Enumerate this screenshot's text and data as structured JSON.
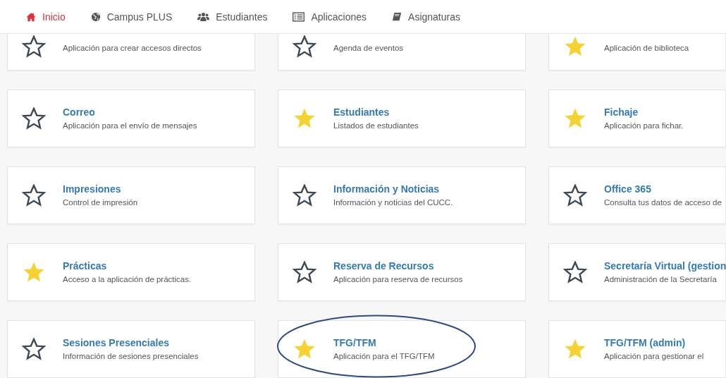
{
  "nav": [
    {
      "label": "Inicio",
      "selected": true
    },
    {
      "label": "Campus PLUS",
      "selected": false
    },
    {
      "label": "Estudiantes",
      "selected": false
    },
    {
      "label": "Aplicaciones",
      "selected": false
    },
    {
      "label": "Asignaturas",
      "selected": false
    }
  ],
  "apps": [
    {
      "description": "Aplicación para crear accesos directos",
      "favorite": false,
      "highlighted": false
    },
    {
      "description": "Agenda de eventos",
      "favorite": false,
      "highlighted": false
    },
    {
      "description": "Aplicación de biblioteca",
      "favorite": true,
      "highlighted": false
    },
    {
      "title": "Correo",
      "description": "Aplicación para el envío de mensajes",
      "favorite": false,
      "highlighted": false
    },
    {
      "title": "Estudiantes",
      "description": "Listados de estudiantes",
      "favorite": true,
      "highlighted": false
    },
    {
      "title": "Fichaje",
      "description": "Aplicación para fichar.",
      "favorite": true,
      "highlighted": false
    },
    {
      "title": "Impresiones",
      "description": "Control de impresión",
      "favorite": false,
      "highlighted": false
    },
    {
      "title": "Información y Noticias",
      "description": "Información y noticias del CUCC.",
      "favorite": false,
      "highlighted": false
    },
    {
      "title": "Office 365",
      "description": "Consulta tus datos de acceso de",
      "favorite": false,
      "highlighted": false
    },
    {
      "title": "Prácticas",
      "description": "Acceso a la aplicación de prácticas.",
      "favorite": true,
      "highlighted": false
    },
    {
      "title": "Reserva de Recursos",
      "description": "Aplicación para reserva de recursos",
      "favorite": false,
      "highlighted": false
    },
    {
      "title": "Secretaría Virtual (gestion",
      "description": "Administración de la Secretaría",
      "favorite": false,
      "highlighted": false
    },
    {
      "title": "Sesiones Presenciales",
      "description": "Información de sesiones presenciales",
      "favorite": false,
      "highlighted": false
    },
    {
      "title": "TFG/TFM",
      "description": "Aplicación para el TFG/TFM",
      "favorite": true,
      "highlighted": true
    },
    {
      "title": "TFG/TFM (admin)",
      "description": "Aplicación para gestionar el",
      "favorite": true,
      "highlighted": false
    }
  ]
}
